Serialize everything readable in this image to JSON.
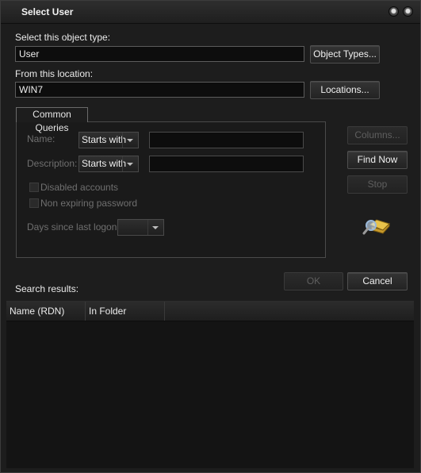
{
  "window": {
    "title": "Select User"
  },
  "object_type": {
    "label": "Select this object type:",
    "value": "User",
    "button": "Object Types..."
  },
  "location": {
    "label": "From this location:",
    "value": "WIN7",
    "button": "Locations..."
  },
  "queries": {
    "tab": "Common Queries",
    "name_label": "Name:",
    "name_mode": "Starts with",
    "name_value": "",
    "description_label": "Description:",
    "description_mode": "Starts with",
    "description_value": "",
    "disabled_accounts": "Disabled accounts",
    "non_expiring_password": "Non expiring password",
    "days_since_logon_label": "Days since last logon:",
    "days_since_logon_value": ""
  },
  "side_buttons": {
    "columns": "Columns...",
    "find_now": "Find Now",
    "stop": "Stop"
  },
  "search_results": {
    "label": "Search results:"
  },
  "dialog_buttons": {
    "ok": "OK",
    "cancel": "Cancel"
  },
  "results_table": {
    "columns": [
      "Name (RDN)",
      "In Folder"
    ]
  }
}
